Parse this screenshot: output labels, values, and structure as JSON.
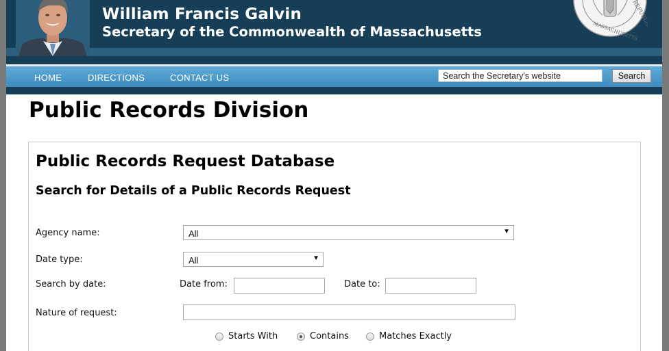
{
  "header": {
    "name": "William Francis Galvin",
    "office": "Secretary of the Commonwealth of Massachusetts",
    "seal_text": "REPUBLICAE MASSACHUSETTS"
  },
  "nav": {
    "items": [
      "HOME",
      "DIRECTIONS",
      "CONTACT US"
    ],
    "search_placeholder": "Search the Secretary's website",
    "search_button": "Search"
  },
  "page": {
    "title": "Public Records Division"
  },
  "panel": {
    "title": "Public Records Request Database",
    "subtitle": "Search for Details of a Public Records Request"
  },
  "form": {
    "agency_label": "Agency name:",
    "agency_value": "All",
    "date_type_label": "Date type:",
    "date_type_value": "All",
    "search_by_date_label": "Search by date:",
    "date_from_label": "Date from:",
    "date_from_value": "",
    "date_to_label": "Date to:",
    "date_to_value": "",
    "nature_label": "Nature of request:",
    "nature_value": "",
    "match_options": [
      "Starts With",
      "Contains",
      "Matches Exactly"
    ],
    "match_selected": "Contains"
  },
  "colors": {
    "banner": "#163e57",
    "nav_bar": "#4b98c9",
    "panel_border": "#c6c6c6"
  }
}
